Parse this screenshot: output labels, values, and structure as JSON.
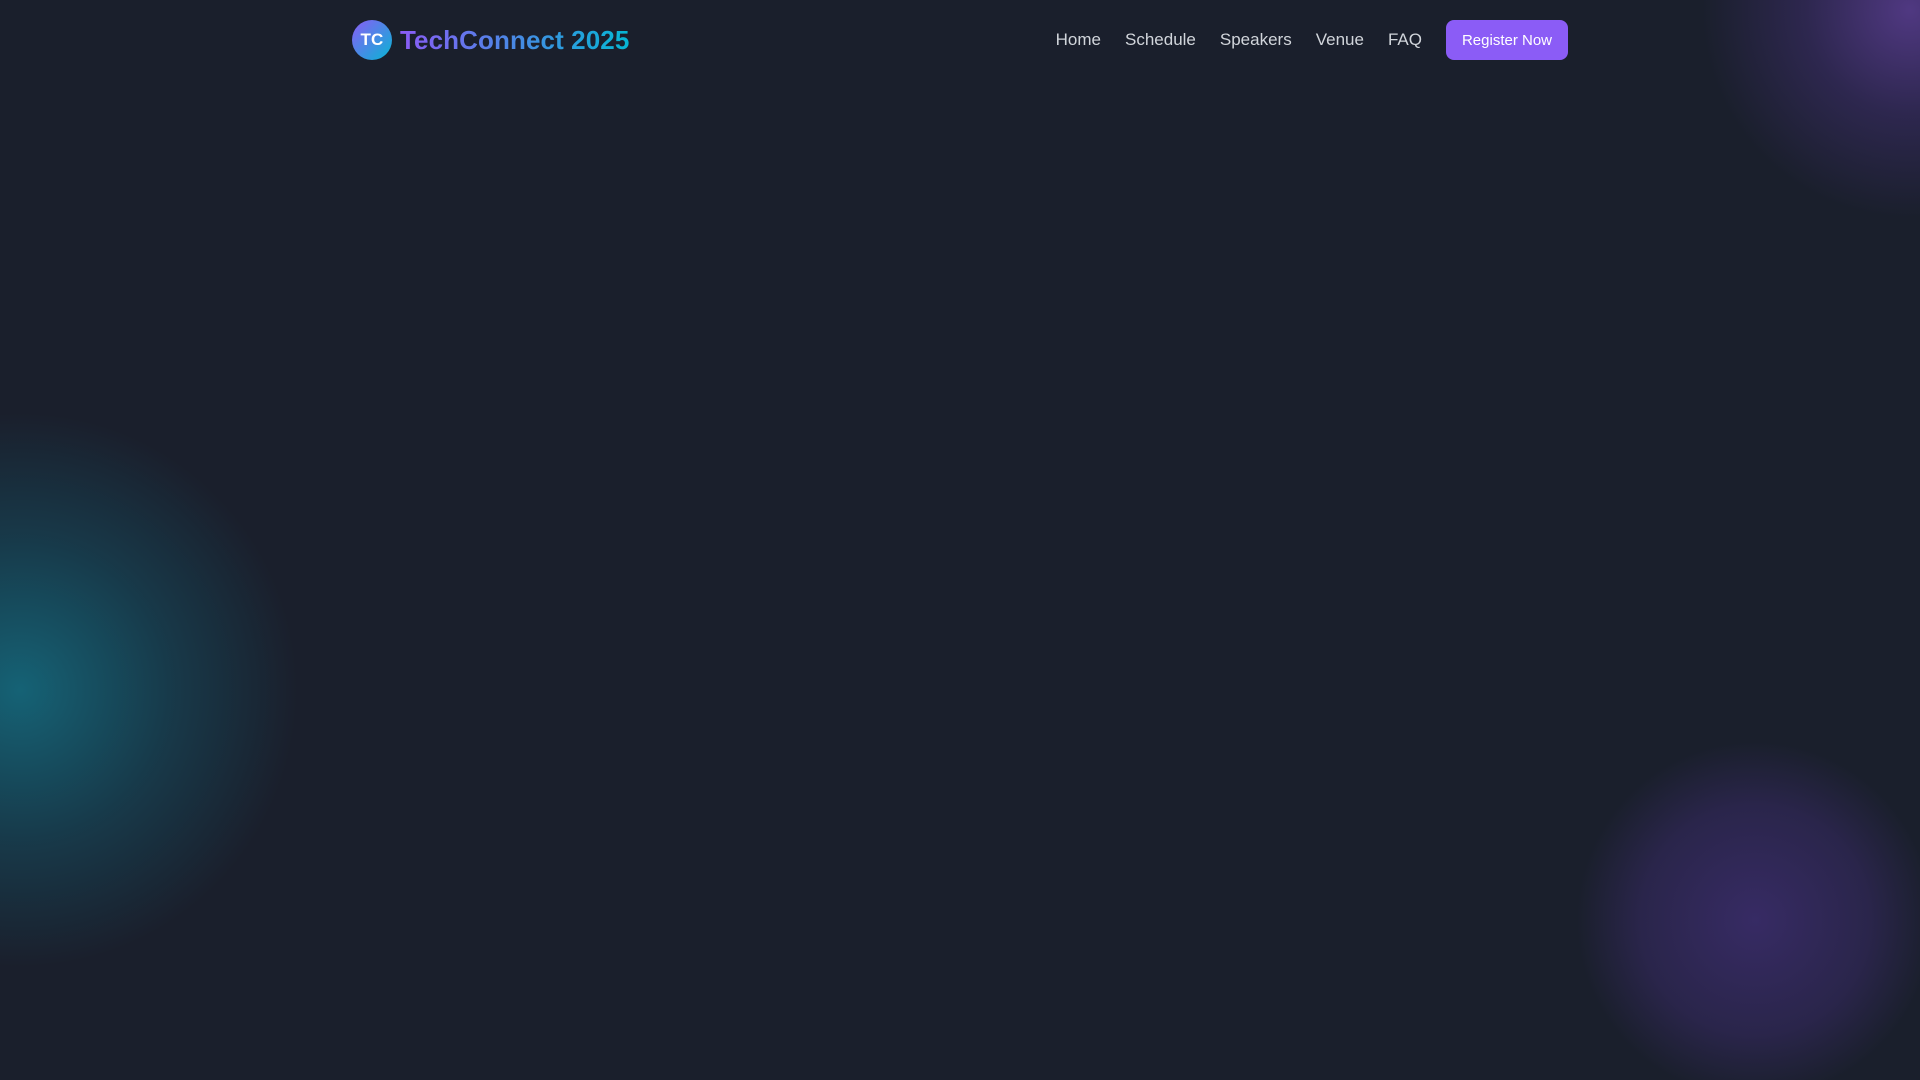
{
  "brand": {
    "logo_text": "TC",
    "name": "TechConnect 2025"
  },
  "nav": {
    "items": [
      {
        "label": "Home"
      },
      {
        "label": "Schedule"
      },
      {
        "label": "Speakers"
      },
      {
        "label": "Venue"
      },
      {
        "label": "FAQ"
      }
    ],
    "cta_label": "Register Now"
  },
  "colors": {
    "background": "#1a1f2c",
    "accent_purple": "#8b5cf6",
    "accent_cyan": "#06b6d4",
    "nav_text": "#d1d5db"
  }
}
